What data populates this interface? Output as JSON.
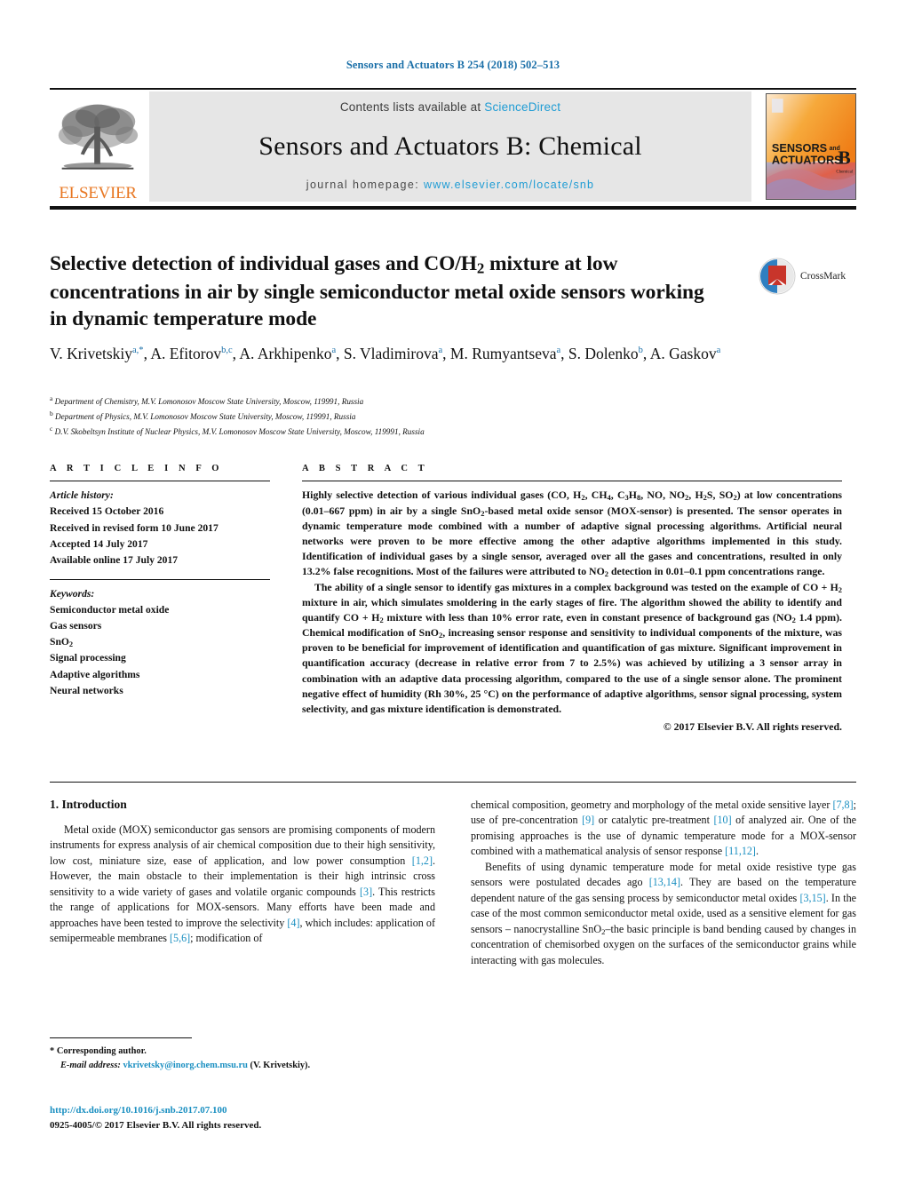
{
  "running_head": "Sensors and Actuators B 254 (2018) 502–513",
  "masthead": {
    "publisher_name": "ELSEVIER",
    "contents_prefix": "Contents lists available at ",
    "contents_link": "ScienceDirect",
    "journal_title": "Sensors and Actuators B: Chemical",
    "homepage_prefix": "journal homepage: ",
    "homepage_url": "www.elsevier.com/locate/snb",
    "cover_line1": "SENSORS",
    "cover_and": "and",
    "cover_line2": "ACTUATORS",
    "cover_letter": "B",
    "cover_sub": "Chemical",
    "colors": {
      "link_blue": "#1f9cd4",
      "elsevier_orange": "#E87722",
      "panel_grey": "#e6e6e6"
    }
  },
  "crossmark": {
    "label": "CrossMark"
  },
  "article": {
    "title_line1": "Selective detection of individual gases and CO/H",
    "title_sub1": "2",
    "title_line1b": " mixture at low",
    "title_line2": "concentrations in air by single semiconductor metal oxide sensors",
    "title_line3": "working in dynamic temperature mode",
    "authors": [
      {
        "name": "V. Krivetskiy",
        "marks": "a,*"
      },
      {
        "name": "A. Efitorov",
        "marks": "b,c"
      },
      {
        "name": "A. Arkhipenko",
        "marks": "a"
      },
      {
        "name": "S. Vladimirova",
        "marks": "a"
      },
      {
        "name": "M. Rumyantseva",
        "marks": "a"
      },
      {
        "name": "S. Dolenko",
        "marks": "b"
      },
      {
        "name": "A. Gaskov",
        "marks": "a"
      }
    ],
    "affiliations": [
      {
        "mark": "a",
        "text": "Department of Chemistry, M.V. Lomonosov Moscow State University, Moscow, 119991, Russia"
      },
      {
        "mark": "b",
        "text": "Department of Physics, M.V. Lomonosov Moscow State University, Moscow, 119991, Russia"
      },
      {
        "mark": "c",
        "text": "D.V. Skobeltsyn Institute of Nuclear Physics, M.V. Lomonosov Moscow State University, Moscow, 119991, Russia"
      }
    ]
  },
  "article_info": {
    "heading": "A R T I C L E   I N F O",
    "history_label": "Article history:",
    "history": [
      "Received 15 October 2016",
      "Received in revised form 10 June 2017",
      "Accepted 14 July 2017",
      "Available online 17 July 2017"
    ],
    "keywords_label": "Keywords:",
    "keywords": [
      "Semiconductor metal oxide",
      "Gas sensors",
      "SnO2",
      "Signal processing",
      "Adaptive algorithms",
      "Neural networks"
    ]
  },
  "abstract": {
    "heading": "A B S T R A C T",
    "paragraph1": "Highly selective detection of various individual gases (CO, H2, CH4, C3H8, NO, NO2, H2S, SO2) at low concentrations (0.01–667 ppm) in air by a single SnO2-based metal oxide sensor (MOX-sensor) is presented. The sensor operates in dynamic temperature mode combined with a number of adaptive signal processing algorithms. Artificial neural networks were proven to be more effective among the other adaptive algorithms implemented in this study. Identification of individual gases by a single sensor, averaged over all the gases and concentrations, resulted in only 13.2% false recognitions. Most of the failures were attributed to NO2 detection in 0.01–0.1 ppm concentrations range.",
    "paragraph2": "The ability of a single sensor to identify gas mixtures in a complex background was tested on the example of CO + H2 mixture in air, which simulates smoldering in the early stages of fire. The algorithm showed the ability to identify and quantify CO + H2 mixture with less than 10% error rate, even in constant presence of background gas (NO2 1.4 ppm). Chemical modification of SnO2, increasing sensor response and sensitivity to individual components of the mixture, was proven to be beneficial for improvement of identification and quantification of gas mixture. Significant improvement in quantification accuracy (decrease in relative error from 7 to 2.5%) was achieved by utilizing a 3 sensor array in combination with an adaptive data processing algorithm, compared to the use of a single sensor alone. The prominent negative effect of humidity (Rh 30%, 25 °C) on the performance of adaptive algorithms, sensor signal processing, system selectivity, and gas mixture identification is demonstrated.",
    "copyright": "© 2017 Elsevier B.V. All rights reserved."
  },
  "introduction": {
    "heading": "1. Introduction",
    "left_para1": "Metal oxide (MOX) semiconductor gas sensors are promising components of modern instruments for express analysis of air chemical composition due to their high sensitivity, low cost, miniature size, ease of application, and low power consumption [1,2]. However, the main obstacle to their implementation is their high intrinsic cross sensitivity to a wide variety of gases and volatile organic compounds [3]. This restricts the range of applications for MOX-sensors. Many efforts have been made and approaches have been tested to improve the selectivity [4], which includes: application of semipermeable membranes [5,6]; modification of",
    "right_para1": "chemical composition, geometry and morphology of the metal oxide sensitive layer [7,8]; use of pre-concentration [9] or catalytic pre-treatment [10] of analyzed air. One of the promising approaches is the use of dynamic temperature mode for a MOX-sensor combined with a mathematical analysis of sensor response [11,12].",
    "right_para2": "Benefits of using dynamic temperature mode for metal oxide resistive type gas sensors were postulated decades ago [13,14]. They are based on the temperature dependent nature of the gas sensing process by semiconductor metal oxides [3,15]. In the case of the most common semiconductor metal oxide, used as a sensitive element for gas sensors – nanocrystalline SnO2–the basic principle is band bending caused by changes in concentration of chemisorbed oxygen on the surfaces of the semiconductor grains while interacting with gas molecules."
  },
  "footer": {
    "corresponding_marker": "*",
    "corresponding_label": "Corresponding author.",
    "email_label": "E-mail address:",
    "email": "vkrivetsky@inorg.chem.msu.ru",
    "email_owner": "(V. Krivetskiy).",
    "doi": "http://dx.doi.org/10.1016/j.snb.2017.07.100",
    "issn_line": "0925-4005/© 2017 Elsevier B.V. All rights reserved."
  }
}
